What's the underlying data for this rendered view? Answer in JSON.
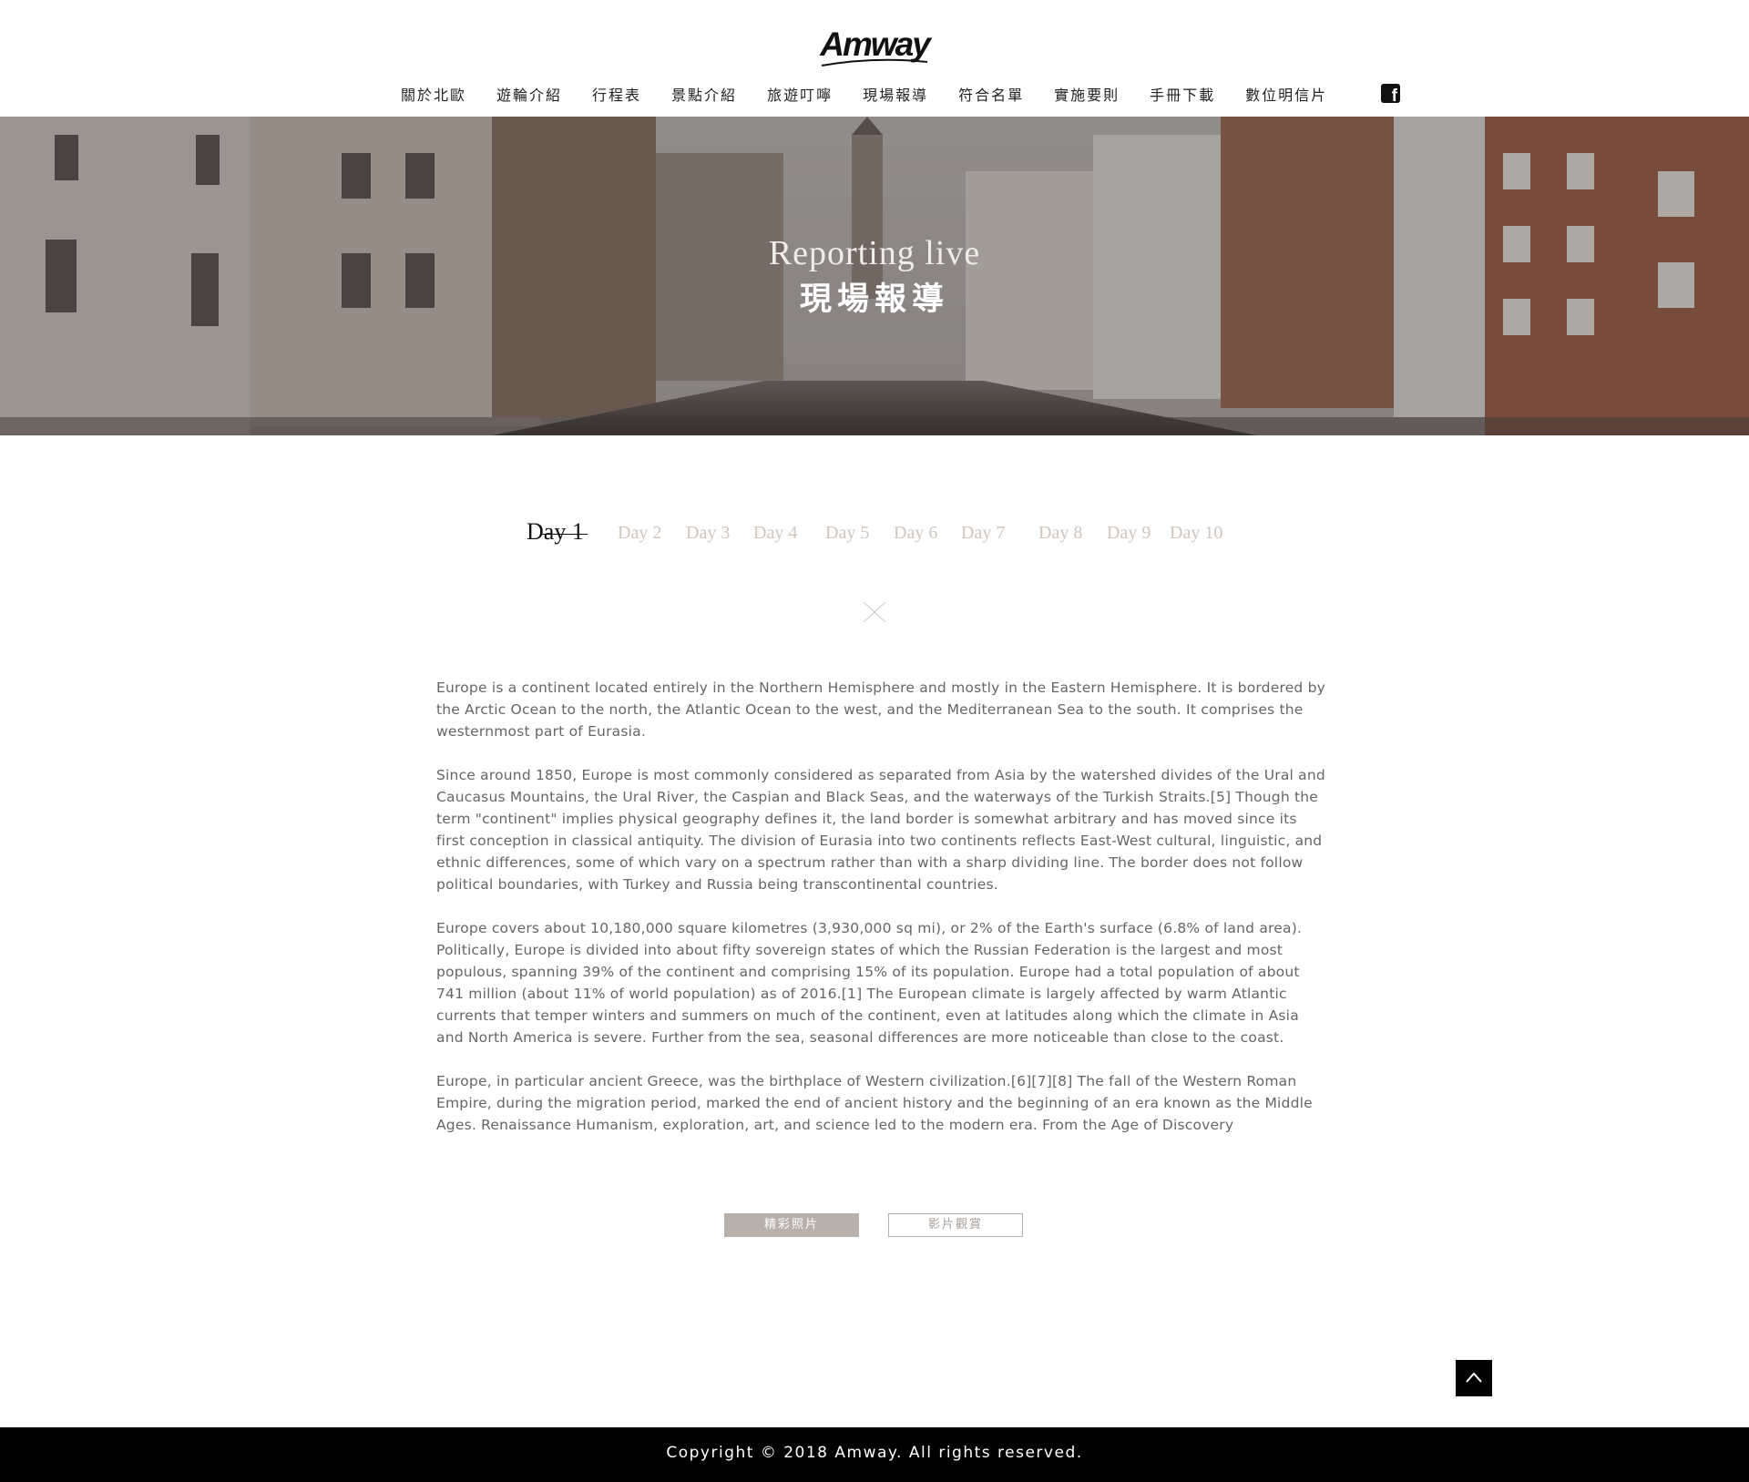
{
  "header": {
    "logo_text": "Amway",
    "nav": [
      {
        "label": "關於北歐"
      },
      {
        "label": "遊輪介紹"
      },
      {
        "label": "行程表"
      },
      {
        "label": "景點介紹"
      },
      {
        "label": "旅遊叮嚀"
      },
      {
        "label": "現場報導"
      },
      {
        "label": "符合名單"
      },
      {
        "label": "實施要則"
      },
      {
        "label": "手冊下載"
      },
      {
        "label": "數位明信片"
      }
    ],
    "social_icon": "facebook-icon"
  },
  "hero": {
    "title_en": "Reporting live",
    "title_zh": "現場報導"
  },
  "days": {
    "active": "Day 1",
    "tabs": [
      "Day 1",
      "Day 2",
      "Day 3",
      "Day 4",
      "Day 5",
      "Day 6",
      "Day 7",
      "Day 8",
      "Day 9",
      "Day 10"
    ]
  },
  "article": {
    "paragraphs": [
      "Europe is a continent located entirely in the Northern Hemisphere and mostly in the Eastern Hemisphere. It is bordered by the Arctic Ocean to the north, the Atlantic Ocean to the west, and the Mediterranean Sea to the south. It comprises the westernmost part of Eurasia.",
      "Since around 1850, Europe is most commonly considered as separated from Asia by the watershed divides of the Ural and Caucasus Mountains, the Ural River, the Caspian and Black Seas, and the waterways of the Turkish Straits.[5] Though the term \"continent\" implies physical geography defines it, the land border is somewhat arbitrary and has moved since its first conception in classical antiquity. The division of Eurasia into two continents reflects East-West cultural, linguistic, and ethnic differences, some of which vary on a spectrum rather than with a sharp dividing line. The border does not follow political boundaries, with Turkey and Russia being transcontinental countries.",
      "Europe covers about 10,180,000 square kilometres (3,930,000 sq mi), or 2% of the Earth's surface (6.8% of land area). Politically, Europe is divided into about fifty sovereign states of which the Russian Federation is the largest and most populous, spanning 39% of the continent and comprising 15% of its population. Europe had a total population of about 741 million (about 11% of world population) as of 2016.[1] The European climate is largely affected by warm Atlantic currents that temper winters and summers on much of the continent, even at latitudes along which the climate in Asia and North America is severe. Further from the sea, seasonal differences are more noticeable than close to the coast.",
      "Europe, in particular ancient Greece, was the birthplace of Western civilization.[6][7][8] The fall of the Western Roman Empire, during the migration period, marked the end of ancient history and the beginning of an era known as the Middle Ages. Renaissance Humanism, exploration, art, and science led to the modern era. From the Age of Discovery"
    ]
  },
  "buttons": {
    "photos": "精彩照片",
    "videos": "影片觀賞"
  },
  "back_to_top_icon": "chevron-up-icon",
  "footer": {
    "copyright": "Copyright © 2018  Amway. All rights reserved."
  },
  "colors": {
    "accent_button": "#b8b0aa",
    "inactive_day": "#cfc6bf",
    "footer_bg": "#000000"
  }
}
